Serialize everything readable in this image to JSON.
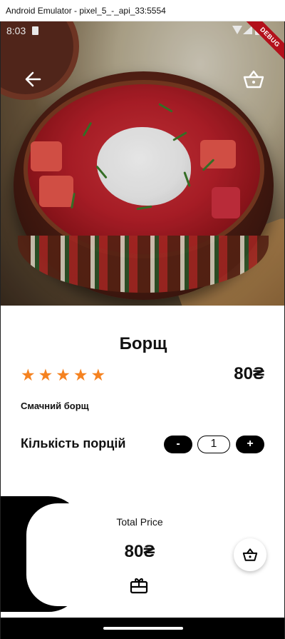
{
  "window": {
    "title": "Android Emulator - pixel_5_-_api_33:5554"
  },
  "status_bar": {
    "time": "8:03"
  },
  "debug_banner": "DEBUG",
  "product": {
    "name": "Борщ",
    "rating": 5,
    "rating_max": 5,
    "price": "80₴",
    "description": "Смачний борщ"
  },
  "quantity": {
    "label": "Кількість порцій",
    "minus_label": "-",
    "value": "1",
    "plus_label": "+"
  },
  "total": {
    "label": "Total Price",
    "value": "80₴"
  },
  "icons": {
    "back": "arrow-back-icon",
    "cart_top": "basket-icon",
    "gift": "gift-card-icon",
    "cart_fab": "basket-icon"
  },
  "colors": {
    "star": "#f58220",
    "button_bg": "#000000",
    "debug_banner": "#b3101b"
  }
}
